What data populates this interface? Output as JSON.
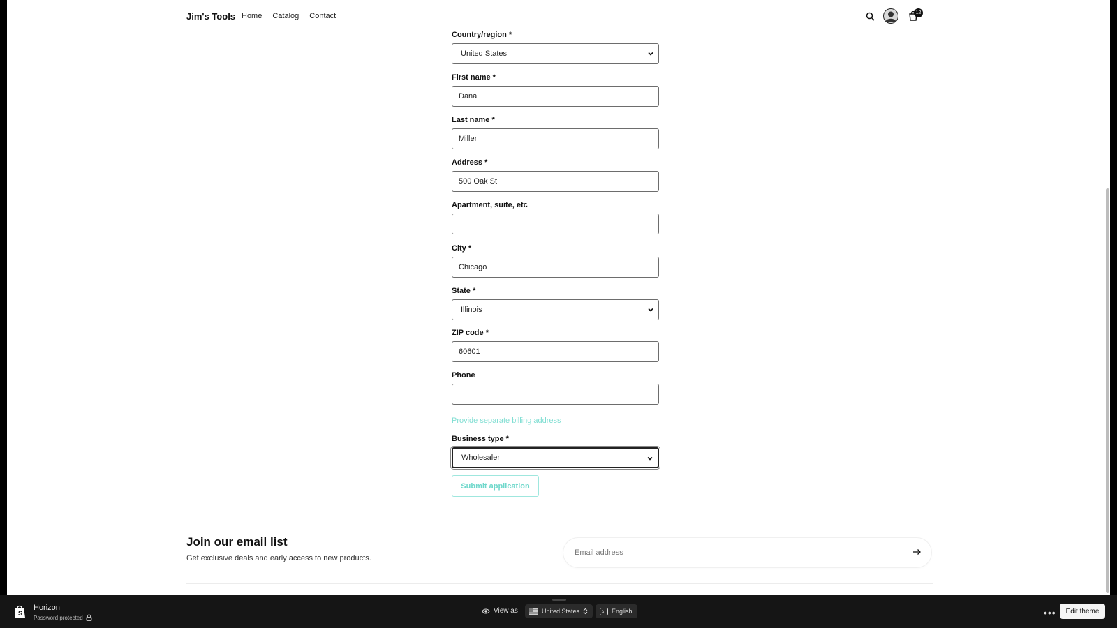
{
  "header": {
    "brand": "Jim's Tools",
    "nav": [
      "Home",
      "Catalog",
      "Contact"
    ],
    "cart_count": "12"
  },
  "form": {
    "fields": [
      {
        "label": "Country/region *",
        "value": "United States",
        "type": "select"
      },
      {
        "label": "First name *",
        "value": "Dana",
        "type": "text"
      },
      {
        "label": "Last name *",
        "value": "Miller",
        "type": "text"
      },
      {
        "label": "Address *",
        "value": "500 Oak St",
        "type": "text"
      },
      {
        "label": "Apartment, suite, etc",
        "value": "",
        "type": "text"
      },
      {
        "label": "City *",
        "value": "Chicago",
        "type": "text"
      },
      {
        "label": "State *",
        "value": "Illinois",
        "type": "select"
      },
      {
        "label": "ZIP code *",
        "value": "60601",
        "type": "text"
      },
      {
        "label": "Phone",
        "value": "",
        "type": "text"
      }
    ],
    "billing_link": "Provide separate billing address",
    "business_type": {
      "label": "Business type *",
      "value": "Wholesaler",
      "type": "select"
    },
    "submit": "Submit application"
  },
  "newsletter": {
    "title": "Join our email list",
    "subtitle": "Get exclusive deals and early access to new products.",
    "email_placeholder": "Email address"
  },
  "admin_bar": {
    "theme": "Horizon",
    "status": "Password protected",
    "view_as": "View as",
    "country": "United States",
    "language": "English",
    "edit": "Edit theme"
  },
  "colors": {
    "accent": "#7fded2",
    "bar_bg": "#151515"
  }
}
